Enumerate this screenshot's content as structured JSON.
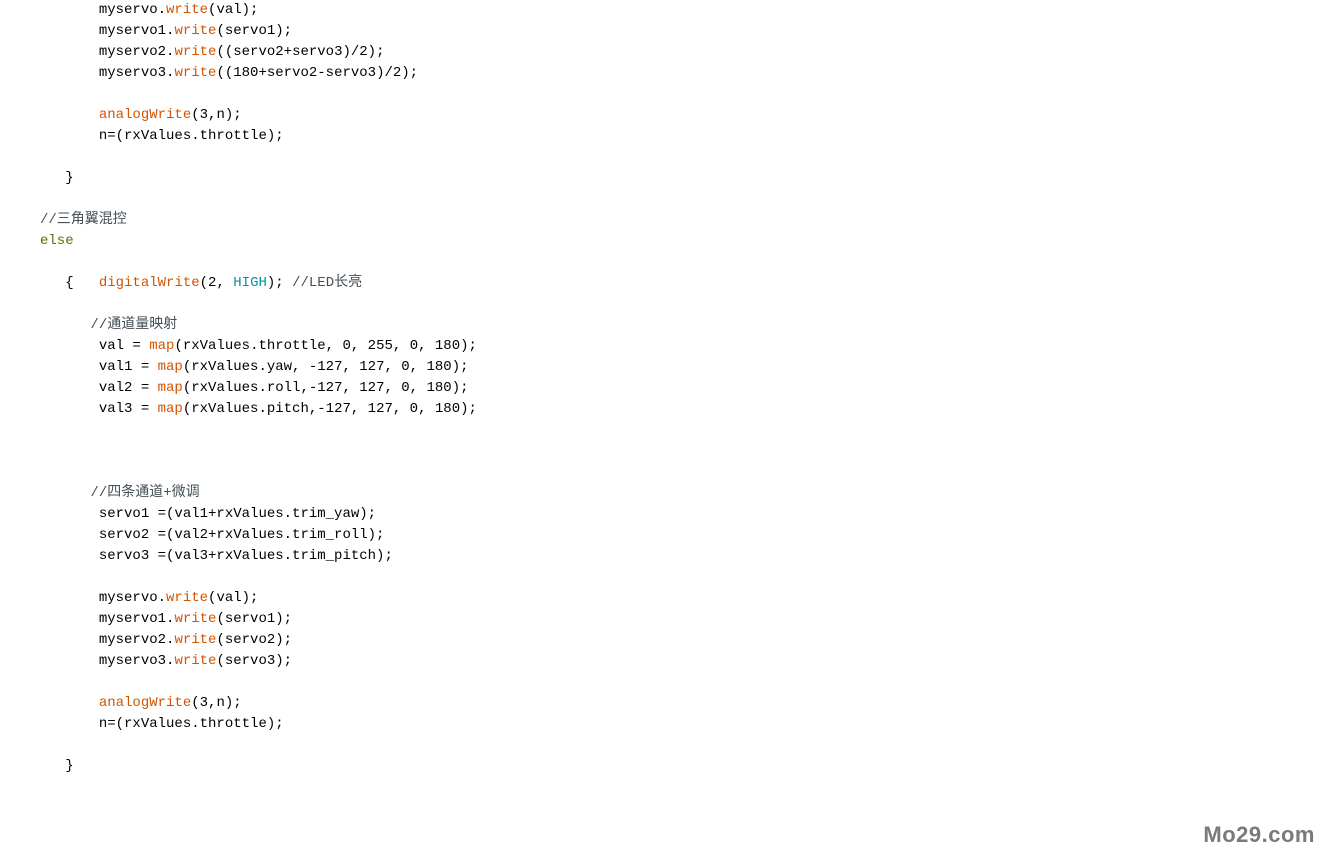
{
  "lines": [
    {
      "indent": 3,
      "segments": [
        {
          "cls": "plain",
          "t": "myservo."
        },
        {
          "cls": "fn-orange",
          "t": "write"
        },
        {
          "cls": "plain",
          "t": "(val);"
        }
      ]
    },
    {
      "indent": 3,
      "segments": [
        {
          "cls": "plain",
          "t": "myservo1."
        },
        {
          "cls": "fn-orange",
          "t": "write"
        },
        {
          "cls": "plain",
          "t": "(servo1);"
        }
      ]
    },
    {
      "indent": 3,
      "segments": [
        {
          "cls": "plain",
          "t": "myservo2."
        },
        {
          "cls": "fn-orange",
          "t": "write"
        },
        {
          "cls": "plain",
          "t": "((servo2+servo3)/2);"
        }
      ]
    },
    {
      "indent": 3,
      "segments": [
        {
          "cls": "plain",
          "t": "myservo3."
        },
        {
          "cls": "fn-orange",
          "t": "write"
        },
        {
          "cls": "plain",
          "t": "((180+servo2-servo3)/2);"
        }
      ]
    },
    {
      "indent": 0,
      "segments": []
    },
    {
      "indent": 3,
      "segments": [
        {
          "cls": "fn-orange",
          "t": "analogWrite"
        },
        {
          "cls": "plain",
          "t": "(3,n);"
        }
      ]
    },
    {
      "indent": 3,
      "segments": [
        {
          "cls": "plain",
          "t": "n=(rxValues.throttle);"
        }
      ]
    },
    {
      "indent": 0,
      "segments": []
    },
    {
      "indent": 1,
      "segments": [
        {
          "cls": "plain",
          "t": "}"
        }
      ]
    },
    {
      "indent": 0,
      "segments": []
    },
    {
      "indent": 0,
      "segments": [
        {
          "cls": "comment",
          "t": "//三角翼混控"
        }
      ]
    },
    {
      "indent": 0,
      "segments": [
        {
          "cls": "kw-else",
          "t": "else"
        }
      ]
    },
    {
      "indent": 0,
      "segments": []
    },
    {
      "indent": 1,
      "segments": [
        {
          "cls": "plain",
          "t": "{   "
        },
        {
          "cls": "fn-orange",
          "t": "digitalWrite"
        },
        {
          "cls": "plain",
          "t": "(2, "
        },
        {
          "cls": "str-blue",
          "t": "HIGH"
        },
        {
          "cls": "plain",
          "t": "); "
        },
        {
          "cls": "comment",
          "t": "//LED长亮"
        }
      ]
    },
    {
      "indent": 0,
      "segments": []
    },
    {
      "indent": 2,
      "segments": [
        {
          "cls": "comment",
          "t": "//通道量映射"
        }
      ]
    },
    {
      "indent": 3,
      "segments": [
        {
          "cls": "plain",
          "t": "val = "
        },
        {
          "cls": "fn-orange",
          "t": "map"
        },
        {
          "cls": "plain",
          "t": "(rxValues.throttle, 0, 255, 0, 180);"
        }
      ]
    },
    {
      "indent": 3,
      "segments": [
        {
          "cls": "plain",
          "t": "val1 = "
        },
        {
          "cls": "fn-orange",
          "t": "map"
        },
        {
          "cls": "plain",
          "t": "(rxValues.yaw, -127, 127, 0, 180);"
        }
      ]
    },
    {
      "indent": 3,
      "segments": [
        {
          "cls": "plain",
          "t": "val2 = "
        },
        {
          "cls": "fn-orange",
          "t": "map"
        },
        {
          "cls": "plain",
          "t": "(rxValues.roll,-127, 127, 0, 180);"
        }
      ]
    },
    {
      "indent": 3,
      "segments": [
        {
          "cls": "plain",
          "t": "val3 = "
        },
        {
          "cls": "fn-orange",
          "t": "map"
        },
        {
          "cls": "plain",
          "t": "(rxValues.pitch,-127, 127, 0, 180);"
        }
      ]
    },
    {
      "indent": 0,
      "segments": []
    },
    {
      "indent": 0,
      "segments": []
    },
    {
      "indent": 0,
      "segments": []
    },
    {
      "indent": 2,
      "segments": [
        {
          "cls": "comment",
          "t": "//四条通道+微调"
        }
      ]
    },
    {
      "indent": 3,
      "segments": [
        {
          "cls": "plain",
          "t": "servo1 =(val1+rxValues.trim_yaw);"
        }
      ]
    },
    {
      "indent": 3,
      "segments": [
        {
          "cls": "plain",
          "t": "servo2 =(val2+rxValues.trim_roll);"
        }
      ]
    },
    {
      "indent": 3,
      "segments": [
        {
          "cls": "plain",
          "t": "servo3 =(val3+rxValues.trim_pitch);"
        }
      ]
    },
    {
      "indent": 0,
      "segments": []
    },
    {
      "indent": 3,
      "segments": [
        {
          "cls": "plain",
          "t": "myservo."
        },
        {
          "cls": "fn-orange",
          "t": "write"
        },
        {
          "cls": "plain",
          "t": "(val);"
        }
      ]
    },
    {
      "indent": 3,
      "segments": [
        {
          "cls": "plain",
          "t": "myservo1."
        },
        {
          "cls": "fn-orange",
          "t": "write"
        },
        {
          "cls": "plain",
          "t": "(servo1);"
        }
      ]
    },
    {
      "indent": 3,
      "segments": [
        {
          "cls": "plain",
          "t": "myservo2."
        },
        {
          "cls": "fn-orange",
          "t": "write"
        },
        {
          "cls": "plain",
          "t": "(servo2);"
        }
      ]
    },
    {
      "indent": 3,
      "segments": [
        {
          "cls": "plain",
          "t": "myservo3."
        },
        {
          "cls": "fn-orange",
          "t": "write"
        },
        {
          "cls": "plain",
          "t": "(servo3);"
        }
      ]
    },
    {
      "indent": 0,
      "segments": []
    },
    {
      "indent": 3,
      "segments": [
        {
          "cls": "fn-orange",
          "t": "analogWrite"
        },
        {
          "cls": "plain",
          "t": "(3,n);"
        }
      ]
    },
    {
      "indent": 3,
      "segments": [
        {
          "cls": "plain",
          "t": "n=(rxValues.throttle);"
        }
      ]
    },
    {
      "indent": 0,
      "segments": []
    },
    {
      "indent": 1,
      "segments": [
        {
          "cls": "plain",
          "t": "}"
        }
      ]
    }
  ],
  "watermark": "Mo29.com"
}
